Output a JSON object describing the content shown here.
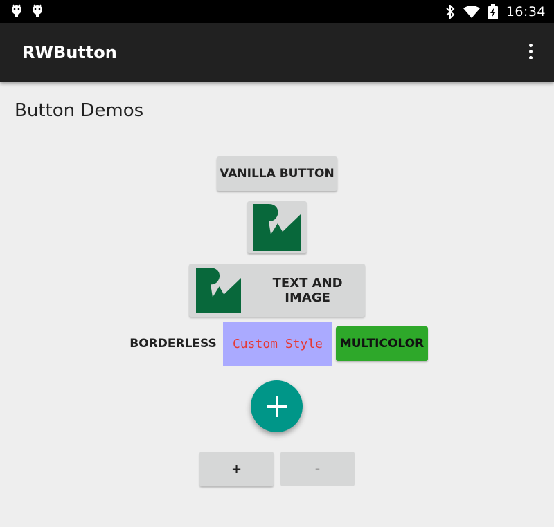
{
  "status_bar": {
    "time": "16:34",
    "icons": [
      "android-debug-icon",
      "android-debug-icon",
      "bluetooth-icon",
      "wifi-icon",
      "battery-charging-icon"
    ]
  },
  "app_bar": {
    "title": "RWButton",
    "menu_icon": "overflow-menu-icon"
  },
  "content": {
    "heading": "Button Demos",
    "vanilla_button": "VANILLA BUTTON",
    "image_button_icon": "rw-logo-icon",
    "text_image_button": "TEXT AND IMAGE",
    "borderless_button": "BORDERLESS",
    "custom_style_button": "Custom Style",
    "multicolor_button": "MULTICOLOR",
    "fab_icon": "add-icon",
    "plus_button": "+",
    "minus_button": "-"
  },
  "colors": {
    "status_bar": "#000000",
    "app_bar": "#212121",
    "background": "#eeeeee",
    "button": "#d6d7d7",
    "custom_style_bg": "#aaaaff",
    "custom_style_text": "#e53935",
    "multicolor_bg": "#2ea82a",
    "fab": "#009688",
    "logo_green": "#08683b"
  }
}
